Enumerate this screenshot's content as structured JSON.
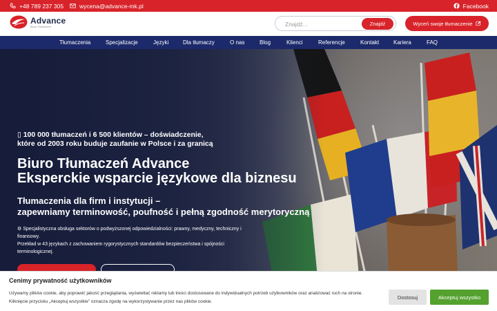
{
  "topbar": {
    "phone": "+48 789 237 305",
    "email": "wycena@advance-mk.pl",
    "facebook": "Facebook"
  },
  "header": {
    "logo_name": "Advance",
    "logo_sub": "Biuro Tłumaczeń",
    "search_placeholder": "Znajdź...",
    "search_button": "Znajdź",
    "quote_button": "Wyceń swoje tłumaczenie"
  },
  "nav": {
    "items": [
      "Tłumaczenia",
      "Specjalizacje",
      "Języki",
      "Dla tłumaczy",
      "O nas",
      "Blog",
      "Klienci",
      "Referencje",
      "Kontakt",
      "Kariera",
      "FAQ"
    ]
  },
  "hero": {
    "intro_line1": "▯ 100 000 tłumaczeń i 6 500 klientów – doświadczenie,",
    "intro_line2": "które od 2003 roku buduje zaufanie w Polsce i za granicą",
    "title_line1": "Biuro Tłumaczeń Advance",
    "title_line2": "Eksperckie wsparcie językowe dla biznesu",
    "sub_line1": "Tłumaczenia dla firm i instytucji –",
    "sub_line2": "zapewniamy terminowość, poufność i pełną zgodność merytoryczną",
    "body_line1": "⚙ Specjalistyczna obsługa sektorów o podwyższonej odpowiedzialności: prawny, medyczny, techniczny i",
    "body_line2": "finansowy.",
    "body_line3": "Przekład w 43 językach z zachowaniem rygorystycznych standardów bezpieczeństwa i spójności",
    "body_line4": "terminologicznej."
  },
  "cookie": {
    "title": "Cenimy prywatność użytkowników",
    "text_line1": "Używamy plików cookie, aby poprawić jakość przeglądania, wyświetlać reklamy lub treści dostosowane do indywidualnych potrzeb użytkowników oraz analizować ruch na stronie.",
    "text_line2": "Kliknięcie przycisku „Akceptuj wszystkie” oznacza zgodę na wykorzystywanie przez nas plików cookie.",
    "decline": "Dostosuj",
    "accept": "Akceptuj wszystko"
  },
  "colors": {
    "brand_red": "#d8232a",
    "nav_blue": "#1c2a6b",
    "accept_green": "#54a12e"
  }
}
